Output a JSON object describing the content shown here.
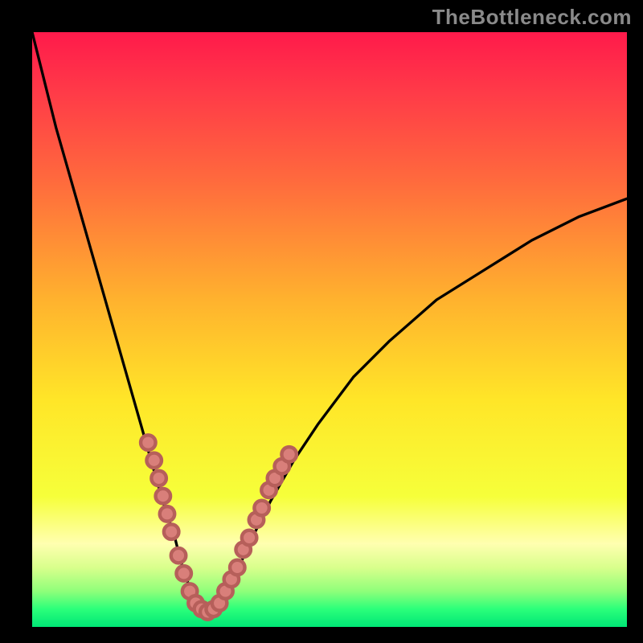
{
  "watermark": "TheBottleneck.com",
  "colors": {
    "frame": "#000000",
    "gradient_stops": [
      {
        "pos": 0.0,
        "color": "#ff1a4b"
      },
      {
        "pos": 0.1,
        "color": "#ff3a48"
      },
      {
        "pos": 0.25,
        "color": "#ff6a3d"
      },
      {
        "pos": 0.45,
        "color": "#ffb22e"
      },
      {
        "pos": 0.62,
        "color": "#ffe628"
      },
      {
        "pos": 0.78,
        "color": "#f6ff3a"
      },
      {
        "pos": 0.86,
        "color": "#ffffb0"
      },
      {
        "pos": 0.9,
        "color": "#d9ff8c"
      },
      {
        "pos": 0.94,
        "color": "#8fff7a"
      },
      {
        "pos": 0.97,
        "color": "#2bff7a"
      },
      {
        "pos": 1.0,
        "color": "#00e676"
      }
    ],
    "curve": "#000000",
    "dot_fill": "#d97f7a",
    "dot_stroke": "#b65f5a"
  },
  "chart_data": {
    "type": "line",
    "title": "",
    "xlabel": "",
    "ylabel": "",
    "xlim": [
      0,
      100
    ],
    "ylim": [
      0,
      100
    ],
    "grid": false,
    "legend": false,
    "series": [
      {
        "name": "bottleneck_curve",
        "x": [
          0,
          2,
          4,
          6,
          8,
          10,
          12,
          14,
          16,
          18,
          20,
          22,
          23,
          24,
          25,
          26,
          27,
          28,
          29,
          30,
          31,
          32,
          33,
          34,
          35,
          36,
          38,
          40,
          44,
          48,
          54,
          60,
          68,
          76,
          84,
          92,
          100
        ],
        "y": [
          100,
          92,
          84,
          77,
          70,
          63,
          56,
          49,
          42,
          35,
          28,
          21,
          18,
          15,
          11,
          8,
          5,
          3,
          2.5,
          2.5,
          3,
          4,
          6,
          8,
          10.5,
          13,
          17,
          21,
          28,
          34,
          42,
          48,
          55,
          60,
          65,
          69,
          72
        ]
      }
    ],
    "annotations": [
      {
        "name": "left_arm_markers",
        "type": "scatter",
        "points": [
          {
            "x": 19.5,
            "y": 31
          },
          {
            "x": 20.5,
            "y": 28
          },
          {
            "x": 21.3,
            "y": 25
          },
          {
            "x": 22.0,
            "y": 22
          },
          {
            "x": 22.7,
            "y": 19
          },
          {
            "x": 23.4,
            "y": 16
          },
          {
            "x": 24.6,
            "y": 12
          },
          {
            "x": 25.5,
            "y": 9
          },
          {
            "x": 26.5,
            "y": 6
          },
          {
            "x": 27.5,
            "y": 4
          },
          {
            "x": 28.5,
            "y": 3
          },
          {
            "x": 29.5,
            "y": 2.5
          },
          {
            "x": 30.5,
            "y": 3
          }
        ]
      },
      {
        "name": "right_arm_markers",
        "type": "scatter",
        "points": [
          {
            "x": 31.5,
            "y": 4
          },
          {
            "x": 32.5,
            "y": 6
          },
          {
            "x": 33.5,
            "y": 8
          },
          {
            "x": 34.5,
            "y": 10
          },
          {
            "x": 35.5,
            "y": 13
          },
          {
            "x": 36.5,
            "y": 15
          },
          {
            "x": 37.7,
            "y": 18
          },
          {
            "x": 38.6,
            "y": 20
          },
          {
            "x": 39.8,
            "y": 23
          },
          {
            "x": 40.8,
            "y": 25
          },
          {
            "x": 42.0,
            "y": 27
          },
          {
            "x": 43.2,
            "y": 29
          }
        ]
      }
    ],
    "min_point": {
      "x": 29.5,
      "y": 2.5
    }
  }
}
